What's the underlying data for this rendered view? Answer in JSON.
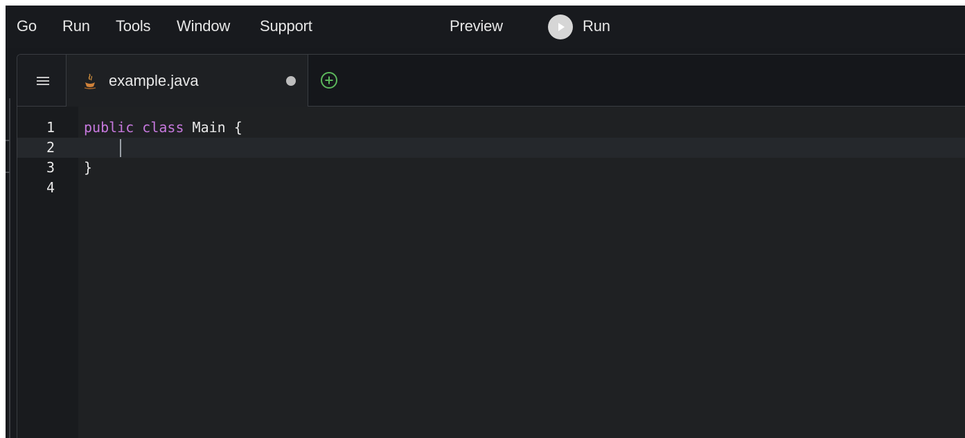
{
  "menu": {
    "items": [
      "Go",
      "Run",
      "Tools",
      "Window",
      "Support"
    ],
    "preview_label": "Preview",
    "run_label": "Run"
  },
  "tabs": [
    {
      "label": "example.java",
      "modified": true,
      "icon": "java-icon"
    }
  ],
  "editor": {
    "lines": [
      {
        "number": "1",
        "tokens": [
          {
            "text": "public",
            "kind": "keyword"
          },
          {
            "text": " "
          },
          {
            "text": "class",
            "kind": "keyword"
          },
          {
            "text": " Main {"
          }
        ]
      },
      {
        "number": "2",
        "tokens": [],
        "active": true
      },
      {
        "number": "3",
        "tokens": [
          {
            "text": "}"
          }
        ]
      },
      {
        "number": "4",
        "tokens": []
      }
    ]
  },
  "colors": {
    "keyword": "#c678dd",
    "text": "#e8e8e8",
    "add_tab": "#5cb85c",
    "background": "#1f2123"
  }
}
